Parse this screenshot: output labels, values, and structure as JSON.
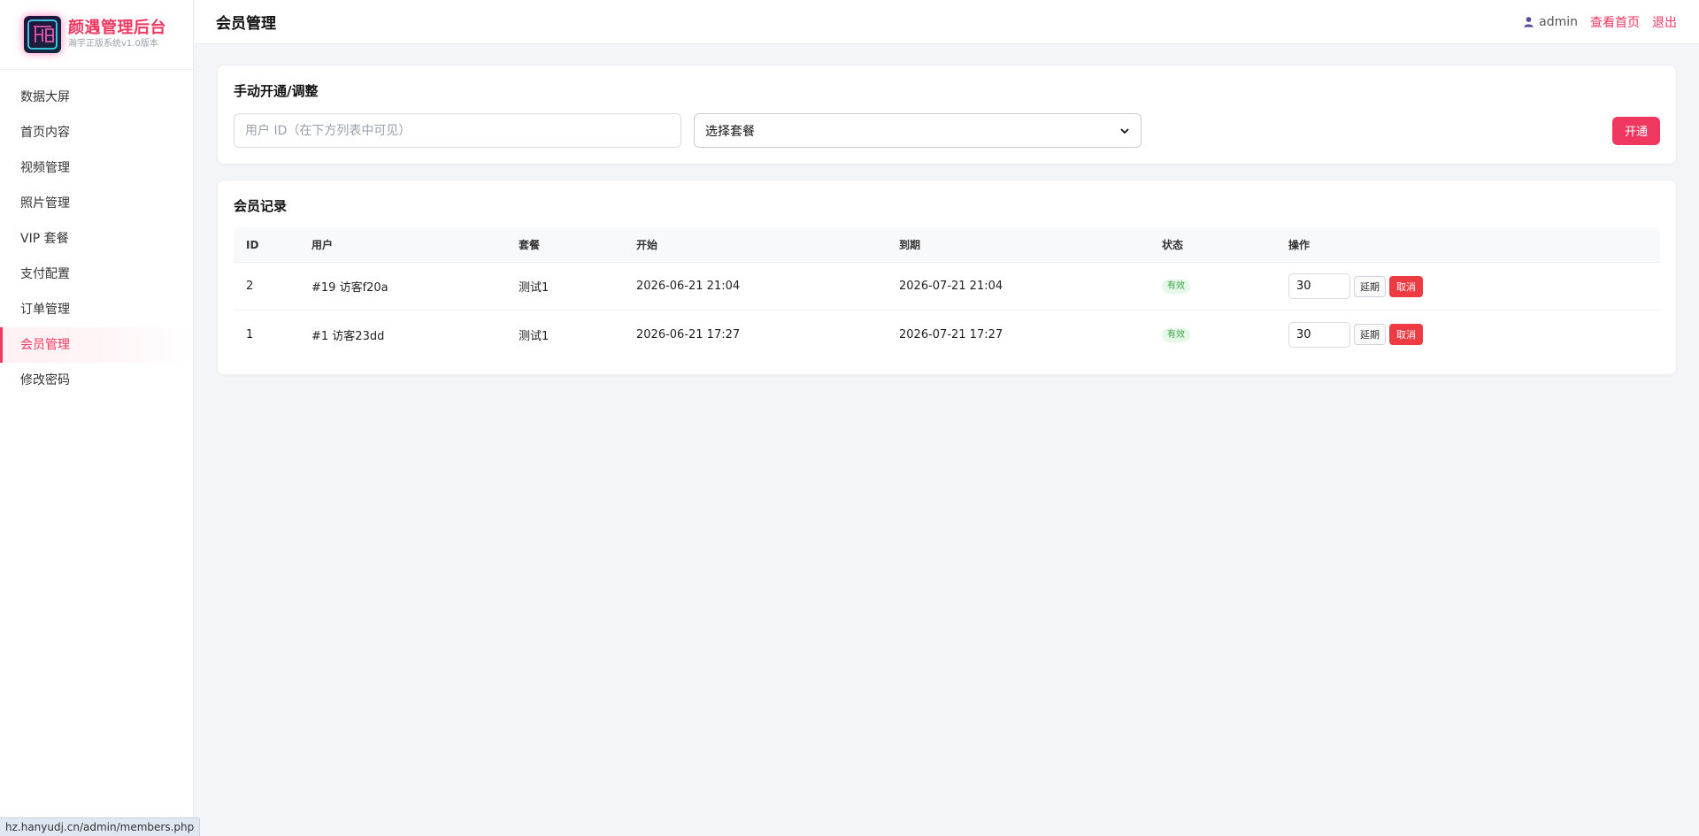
{
  "brand": {
    "title": "颜遇管理后台",
    "subtitle": "瀚宇正版系统v1.0版本",
    "logo_icon": "logo-glyph",
    "accent": "#f0375f"
  },
  "sidebar": {
    "items": [
      {
        "label": "数据大屏",
        "active": false
      },
      {
        "label": "首页内容",
        "active": false
      },
      {
        "label": "视频管理",
        "active": false
      },
      {
        "label": "照片管理",
        "active": false
      },
      {
        "label": "VIP 套餐",
        "active": false
      },
      {
        "label": "支付配置",
        "active": false
      },
      {
        "label": "订单管理",
        "active": false
      },
      {
        "label": "会员管理",
        "active": true
      },
      {
        "label": "修改密码",
        "active": false
      }
    ]
  },
  "header": {
    "title": "会员管理",
    "user": "admin",
    "user_icon": "user-icon",
    "view_home": "查看首页",
    "logout": "退出"
  },
  "manual": {
    "title": "手动开通/调整",
    "uid_placeholder": "用户 ID（在下方列表中可见）",
    "uid_value": "",
    "plan_selected": "选择套餐",
    "submit_label": "开通"
  },
  "records": {
    "title": "会员记录",
    "columns": {
      "id": "ID",
      "user": "用户",
      "plan": "套餐",
      "start": "开始",
      "end": "到期",
      "status": "状态",
      "ops": "操作"
    },
    "rows": [
      {
        "id": "2",
        "user": "#19 访客f20a",
        "plan": "测试1",
        "start": "2026-06-21 21:04",
        "end": "2026-07-21 21:04",
        "status": "有效",
        "days": "30",
        "extend": "延期",
        "cancel": "取消"
      },
      {
        "id": "1",
        "user": "#1 访客23dd",
        "plan": "测试1",
        "start": "2026-06-21 17:27",
        "end": "2026-07-21 17:27",
        "status": "有效",
        "days": "30",
        "extend": "延期",
        "cancel": "取消"
      }
    ]
  },
  "statusbar": {
    "url": "hz.hanyudj.cn/admin/members.php"
  }
}
